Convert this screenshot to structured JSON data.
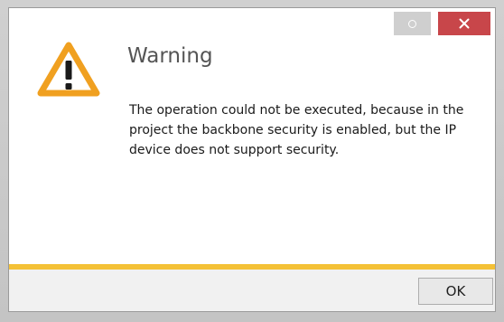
{
  "dialog": {
    "title": "Warning",
    "message": "The operation could not be executed, because in the project the backbone security is enabled, but the IP device does not support security.",
    "ok_label": "OK",
    "accent_color": "#f4c136",
    "close_button_color": "#c8464a",
    "icon": "warning-triangle-icon"
  }
}
